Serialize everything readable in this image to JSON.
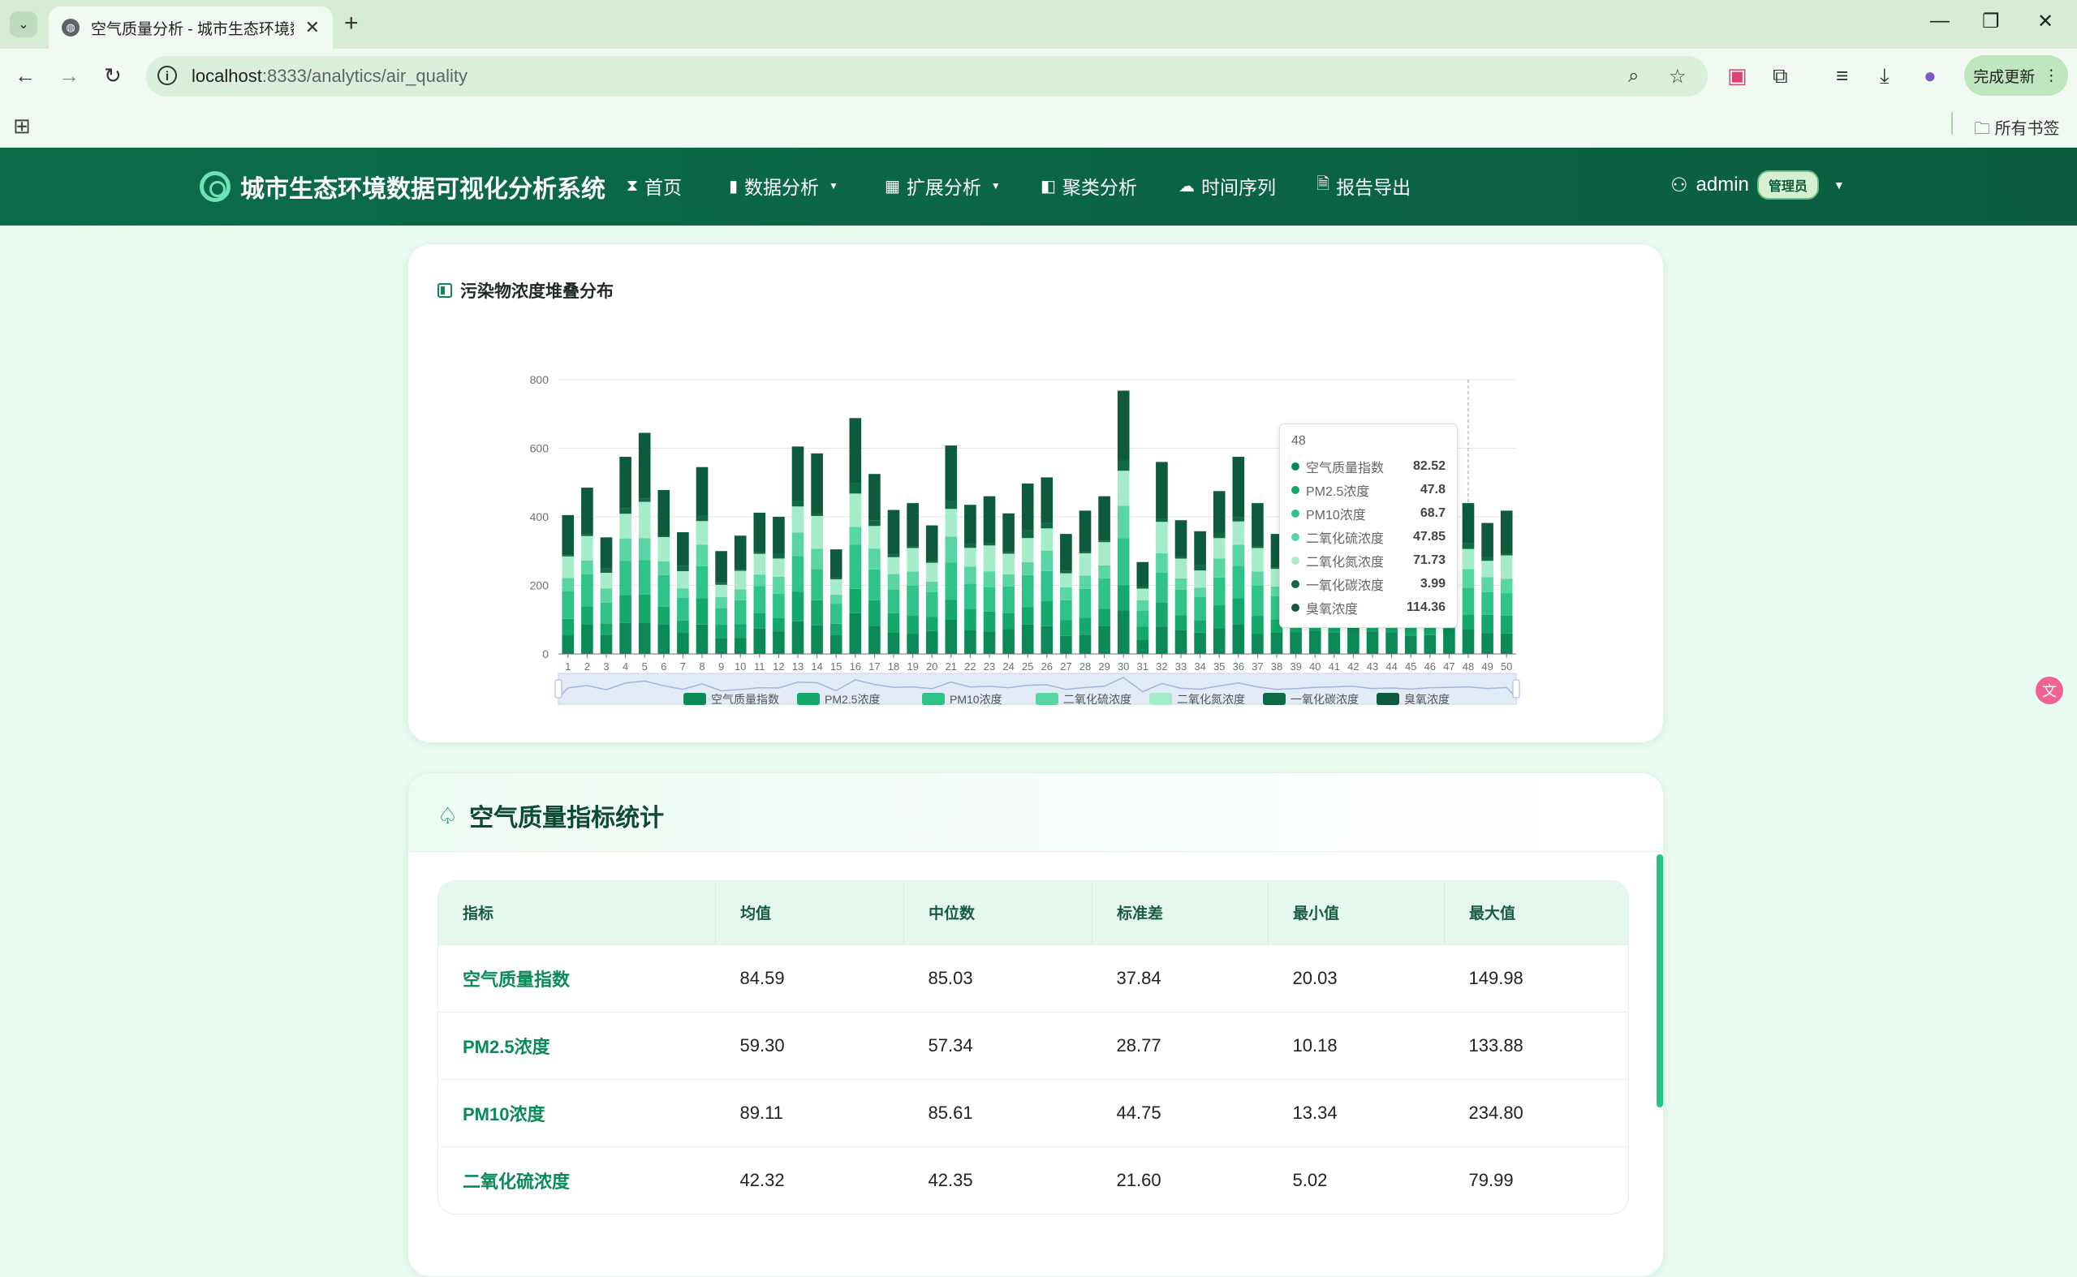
{
  "browser": {
    "tab_title": "空气质量分析 - 城市生态环境数",
    "url_host": "localhost",
    "url_rest": ":8333/analytics/air_quality",
    "update_label": "完成更新",
    "bookmarks_label": "所有书签"
  },
  "nav": {
    "brand": "城市生态环境数据可视化分析系统",
    "items": [
      "首页",
      "数据分析",
      "扩展分析",
      "聚类分析",
      "时间序列",
      "报告导出"
    ],
    "user": "admin",
    "role": "管理员"
  },
  "chart_card": {
    "title": "污染物浓度堆叠分布"
  },
  "chart_data": {
    "type": "bar",
    "stacked": true,
    "ylim": [
      0,
      800
    ],
    "yticks": [
      0,
      200,
      400,
      600,
      800
    ],
    "categories": [
      "1",
      "2",
      "3",
      "4",
      "5",
      "6",
      "7",
      "8",
      "9",
      "10",
      "11",
      "12",
      "13",
      "14",
      "15",
      "16",
      "17",
      "18",
      "19",
      "20",
      "21",
      "22",
      "23",
      "24",
      "25",
      "26",
      "27",
      "28",
      "29",
      "30",
      "31",
      "32",
      "33",
      "34",
      "35",
      "36",
      "37",
      "38",
      "39",
      "40",
      "41",
      "42",
      "43",
      "44",
      "45",
      "46",
      "47",
      "48",
      "49",
      "50"
    ],
    "totals": [
      405,
      485,
      340,
      575,
      645,
      478,
      355,
      545,
      300,
      345,
      412,
      400,
      605,
      585,
      305,
      688,
      525,
      420,
      440,
      375,
      608,
      435,
      460,
      410,
      497,
      515,
      350,
      418,
      460,
      768,
      268,
      560,
      390,
      358,
      475,
      575,
      440,
      350,
      380,
      420,
      440,
      460,
      380,
      400,
      360,
      410,
      420,
      440,
      382,
      418
    ],
    "series": [
      {
        "name": "空气质量指数",
        "color": "#0b8a57",
        "share": 0.16
      },
      {
        "name": "PM2.5浓度",
        "color": "#14a86a",
        "share": 0.12
      },
      {
        "name": "PM10浓度",
        "color": "#2fc38a",
        "share": 0.18
      },
      {
        "name": "二氧化硫浓度",
        "color": "#5ad6a4",
        "share": 0.1
      },
      {
        "name": "二氧化氮浓度",
        "color": "#a6ecc8",
        "share": 0.14
      },
      {
        "name": "一氧化碳浓度",
        "color": "#0e6a45",
        "share": 0.02
      },
      {
        "name": "臭氧浓度",
        "color": "#0d5a3c",
        "share": 0.28
      }
    ],
    "tooltip": {
      "category": "48",
      "rows": [
        {
          "name": "空气质量指数",
          "value": "82.52",
          "color": "#0b8a57"
        },
        {
          "name": "PM2.5浓度",
          "value": "47.8",
          "color": "#14a86a"
        },
        {
          "name": "PM10浓度",
          "value": "68.7",
          "color": "#2fc38a"
        },
        {
          "name": "二氧化硫浓度",
          "value": "47.85",
          "color": "#5ad6a4"
        },
        {
          "name": "二氧化氮浓度",
          "value": "71.73",
          "color": "#a6ecc8"
        },
        {
          "name": "一氧化碳浓度",
          "value": "3.99",
          "color": "#0e6a45"
        },
        {
          "name": "臭氧浓度",
          "value": "114.36",
          "color": "#0d5a3c"
        }
      ]
    }
  },
  "stats": {
    "title": "空气质量指标统计",
    "headers": [
      "指标",
      "均值",
      "中位数",
      "标准差",
      "最小值",
      "最大值"
    ],
    "rows": [
      [
        "空气质量指数",
        "84.59",
        "85.03",
        "37.84",
        "20.03",
        "149.98"
      ],
      [
        "PM2.5浓度",
        "59.30",
        "57.34",
        "28.77",
        "10.18",
        "133.88"
      ],
      [
        "PM10浓度",
        "89.11",
        "85.61",
        "44.75",
        "13.34",
        "234.80"
      ],
      [
        "二氧化硫浓度",
        "42.32",
        "42.35",
        "21.60",
        "5.02",
        "79.99"
      ]
    ]
  }
}
